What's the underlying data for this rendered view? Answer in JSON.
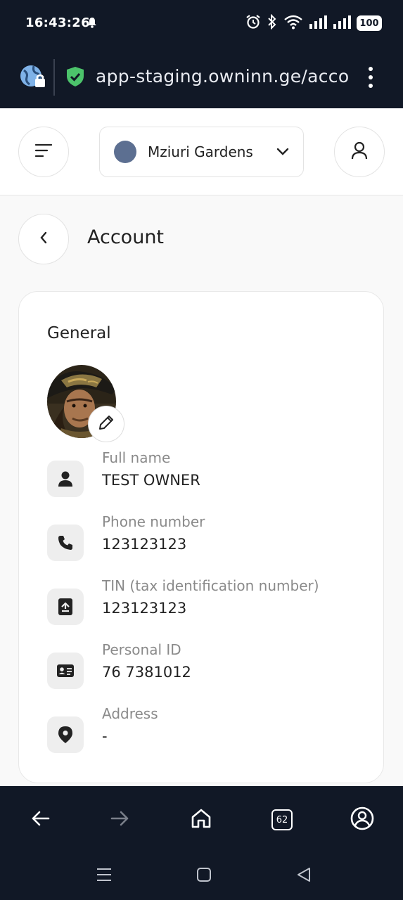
{
  "status_bar": {
    "time": "16:43:26",
    "battery": "100"
  },
  "browser": {
    "url": "app-staging.owninn.ge/account"
  },
  "header": {
    "property_name": "Mziuri Gardens"
  },
  "page": {
    "title": "Account"
  },
  "general": {
    "section_title": "General",
    "fields": [
      {
        "label": "Full name",
        "value": "TEST OWNER",
        "icon": "person-icon"
      },
      {
        "label": "Phone number",
        "value": "123123123",
        "icon": "phone-icon"
      },
      {
        "label": "TIN (tax identification number)",
        "value": "123123123",
        "icon": "tax-document-icon"
      },
      {
        "label": "Personal ID",
        "value": "76 7381012",
        "icon": "id-card-icon"
      },
      {
        "label": "Address",
        "value": "-",
        "icon": "location-pin-icon"
      }
    ]
  },
  "browser_nav": {
    "tabs_count": "62"
  },
  "colors": {
    "dark_bar": "#111826",
    "accent_shield": "#4cc36b",
    "property_dot": "#5c6f91"
  }
}
